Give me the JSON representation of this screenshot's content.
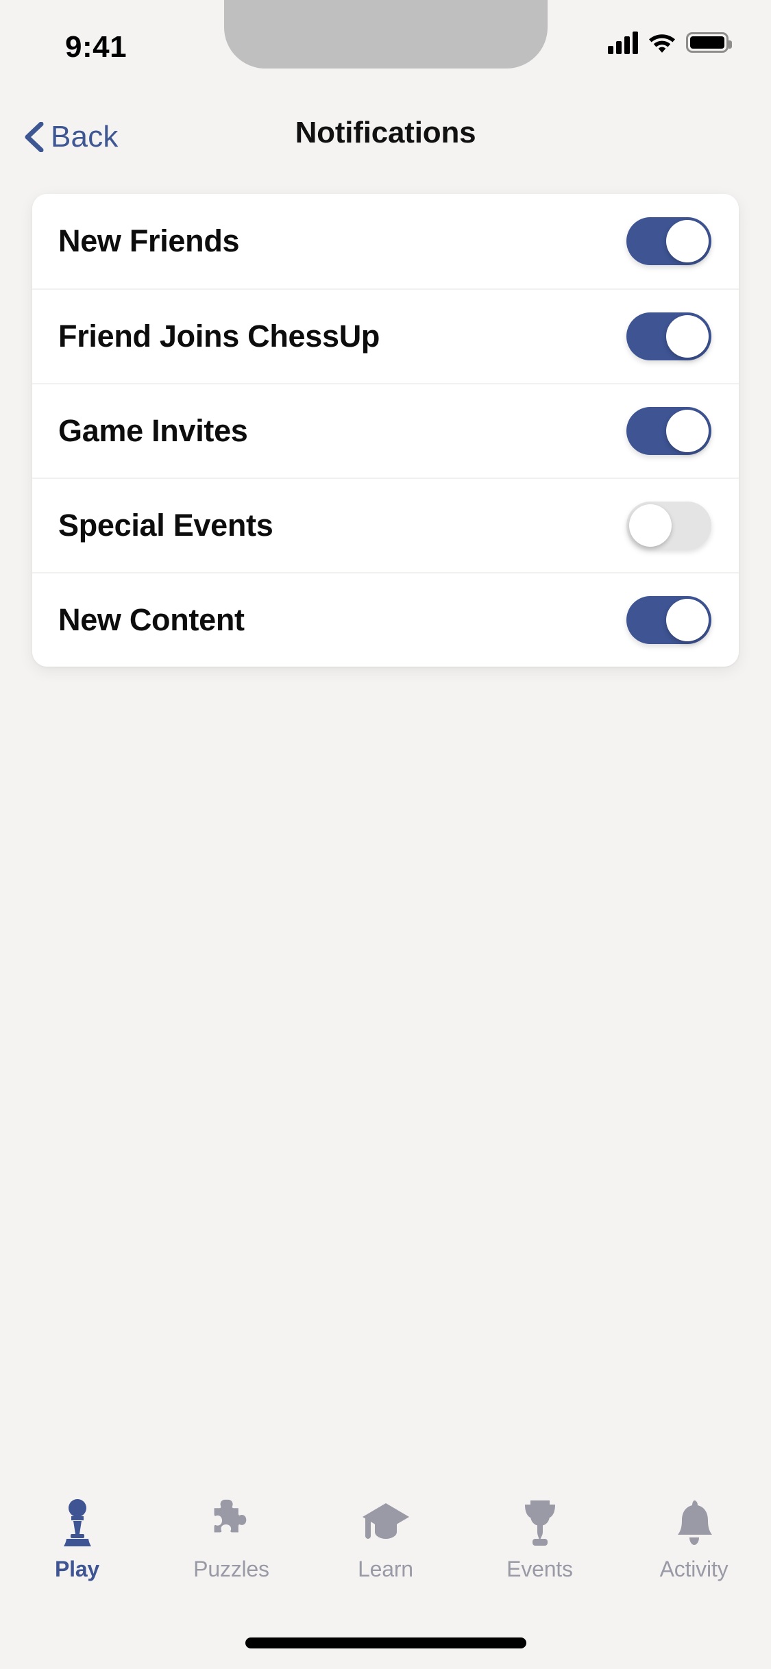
{
  "status_bar": {
    "time": "9:41",
    "cellular_icon": "signal-bars-icon",
    "wifi_icon": "wifi-icon",
    "battery_icon": "battery-full-icon"
  },
  "nav": {
    "back_label": "Back",
    "back_icon": "chevron-left-icon",
    "title": "Notifications"
  },
  "settings": {
    "rows": [
      {
        "label": "New Friends",
        "state": "on",
        "state_label": "On"
      },
      {
        "label": "Friend Joins ChessUp",
        "state": "on",
        "state_label": "On"
      },
      {
        "label": "Game Invites",
        "state": "on",
        "state_label": "On"
      },
      {
        "label": "Special Events",
        "state": "off",
        "state_label": "Off"
      },
      {
        "label": "New Content",
        "state": "on",
        "state_label": "On"
      }
    ]
  },
  "tab_bar": {
    "items": [
      {
        "label": "Play",
        "icon": "chess-pawn-icon",
        "active": true
      },
      {
        "label": "Puzzles",
        "icon": "puzzle-piece-icon",
        "active": false
      },
      {
        "label": "Learn",
        "icon": "graduation-cap-icon",
        "active": false
      },
      {
        "label": "Events",
        "icon": "trophy-icon",
        "active": false
      },
      {
        "label": "Activity",
        "icon": "bell-icon",
        "active": false
      }
    ]
  },
  "colors": {
    "accent": "#3E5493",
    "background": "#F4F3F1",
    "card": "#FFFFFF",
    "toggle_on": "#3E5493",
    "toggle_off": "#E4E4E4",
    "inactive_tab": "#9A9AA6"
  }
}
